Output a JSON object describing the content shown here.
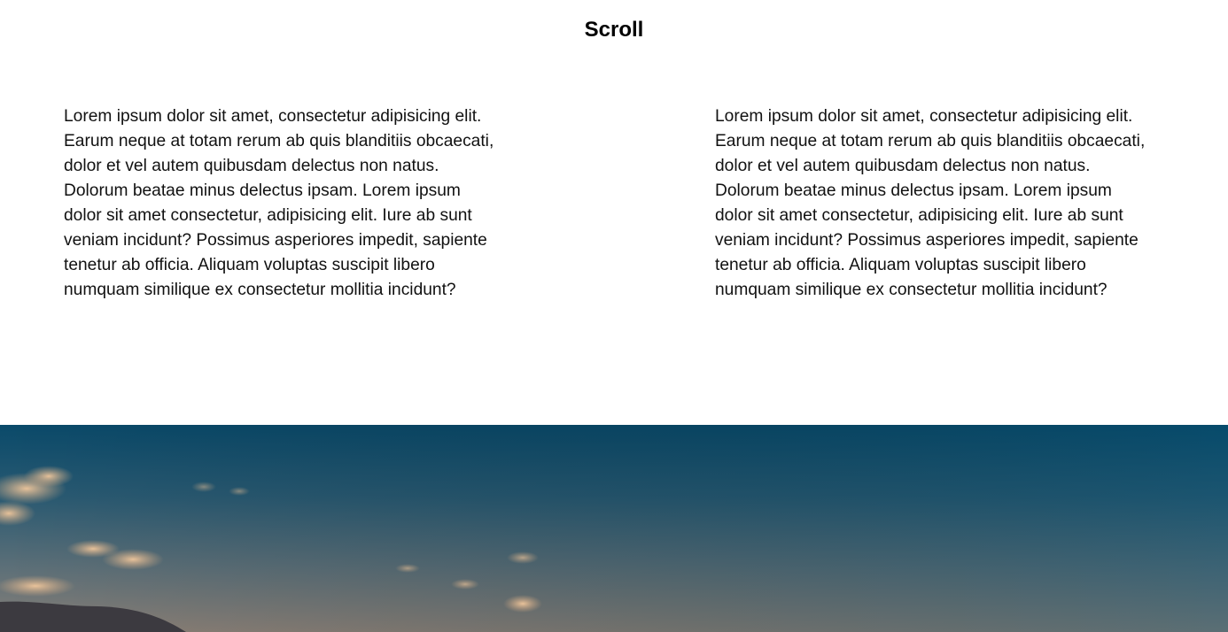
{
  "page": {
    "title": "Scroll"
  },
  "columns": [
    {
      "text": "Lorem ipsum dolor sit amet, consectetur adipisicing elit. Earum neque at totam rerum ab quis blanditiis obcaecati, dolor et vel autem quibusdam delectus non natus. Dolorum beatae minus delectus ipsam. Lorem ipsum dolor sit amet consectetur, adipisicing elit. Iure ab sunt veniam incidunt? Possimus asperiores impedit, sapiente tenetur ab officia. Aliquam voluptas suscipit libero numquam similique ex consectetur mollitia incidunt?"
    },
    {
      "text": "Lorem ipsum dolor sit amet, consectetur adipisicing elit. Earum neque at totam rerum ab quis blanditiis obcaecati, dolor et vel autem quibusdam delectus non natus. Dolorum beatae minus delectus ipsam. Lorem ipsum dolor sit amet consectetur, adipisicing elit. Iure ab sunt veniam incidunt? Possimus asperiores impedit, sapiente tenetur ab officia. Aliquam voluptas suscipit libero numquam similique ex consectetur mollitia incidunt?"
    }
  ],
  "hero": {
    "sky_top_color": "#004c6d",
    "sky_bottom_color": "#8e8479",
    "cloud_color": "#e0b890",
    "hill_color": "#3c3a40"
  }
}
